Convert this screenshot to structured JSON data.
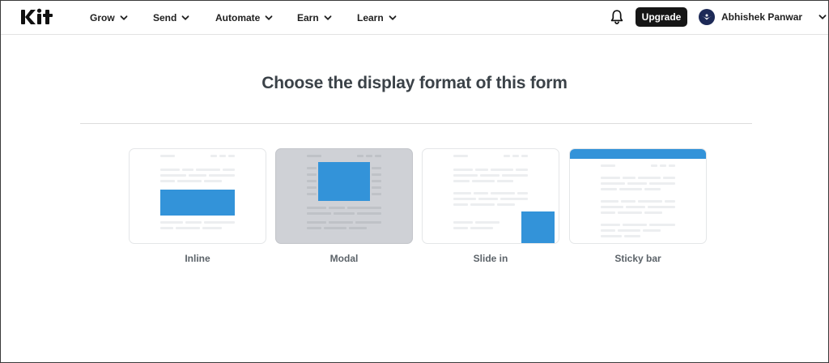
{
  "brand": {
    "logo_text": "kit"
  },
  "nav": {
    "items": [
      {
        "label": "Grow"
      },
      {
        "label": "Send"
      },
      {
        "label": "Automate"
      },
      {
        "label": "Earn"
      },
      {
        "label": "Learn"
      }
    ]
  },
  "header": {
    "upgrade_label": "Upgrade",
    "user_name": "Abhishek Panwar",
    "notifications_icon": "bell-icon"
  },
  "main": {
    "title": "Choose the display format of this form",
    "formats": [
      {
        "label": "Inline",
        "selected": false
      },
      {
        "label": "Modal",
        "selected": true
      },
      {
        "label": "Slide in",
        "selected": false
      },
      {
        "label": "Sticky bar",
        "selected": false
      }
    ]
  },
  "colors": {
    "accent_blue": "#3393d9",
    "selected_card": "#cfd1d6",
    "upgrade_bg": "#161616"
  }
}
